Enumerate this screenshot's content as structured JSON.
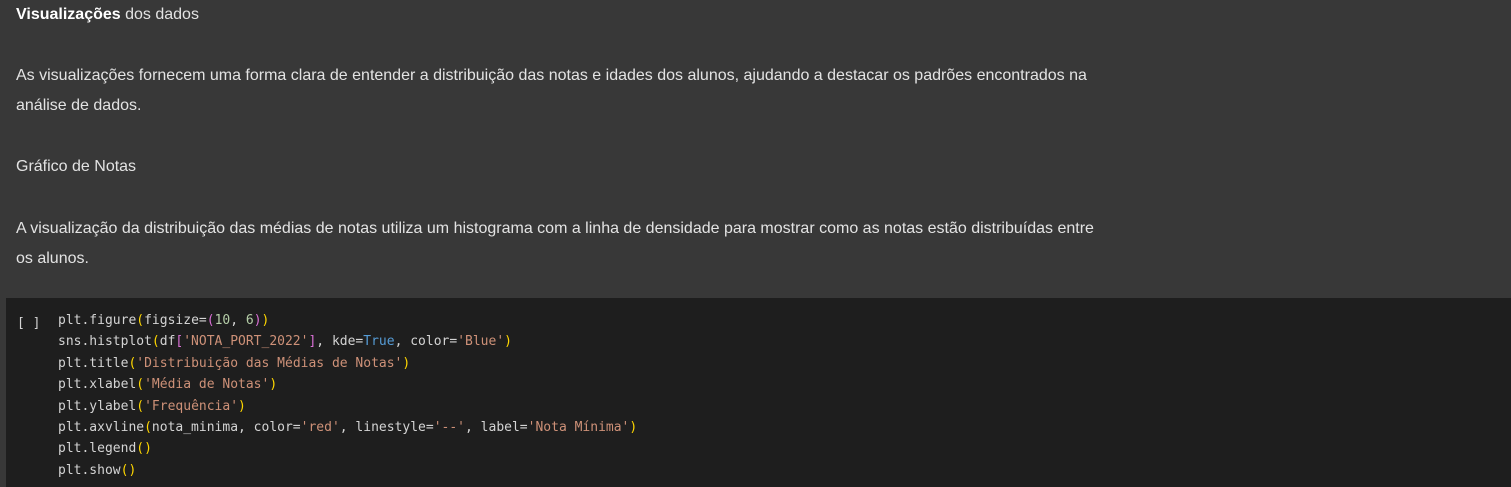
{
  "text_cell": {
    "heading_bold": "Visualizações",
    "heading_rest": " dos dados",
    "paragraph_1": "As visualizações fornecem uma forma clara de entender a distribuição das notas e idades dos alunos, ajudando a destacar os padrões encontrados na análise de dados.",
    "paragraph_2": "Gráfico de Notas",
    "paragraph_3": "A visualização da distribuição das médias de notas utiliza um histograma com a linha de densidade para mostrar como as notas estão distribuídas entre os alunos."
  },
  "code_cell": {
    "run_indicator": "[ ]",
    "lines": [
      [
        [
          "plain",
          "plt.figure"
        ],
        [
          "paren1",
          "("
        ],
        [
          "plain",
          "figsize="
        ],
        [
          "paren2",
          "("
        ],
        [
          "num",
          "10"
        ],
        [
          "plain",
          ", "
        ],
        [
          "num",
          "6"
        ],
        [
          "paren2",
          ")"
        ],
        [
          "paren1",
          ")"
        ]
      ],
      [
        [
          "plain",
          "sns.histplot"
        ],
        [
          "paren1",
          "("
        ],
        [
          "plain",
          "df"
        ],
        [
          "paren2",
          "["
        ],
        [
          "str",
          "'NOTA_PORT_2022'"
        ],
        [
          "paren2",
          "]"
        ],
        [
          "plain",
          ", kde="
        ],
        [
          "kw",
          "True"
        ],
        [
          "plain",
          ", color="
        ],
        [
          "str",
          "'Blue'"
        ],
        [
          "paren1",
          ")"
        ]
      ],
      [
        [
          "plain",
          "plt.title"
        ],
        [
          "paren1",
          "("
        ],
        [
          "str",
          "'Distribuição das Médias de Notas'"
        ],
        [
          "paren1",
          ")"
        ]
      ],
      [
        [
          "plain",
          "plt.xlabel"
        ],
        [
          "paren1",
          "("
        ],
        [
          "str",
          "'Média de Notas'"
        ],
        [
          "paren1",
          ")"
        ]
      ],
      [
        [
          "plain",
          "plt.ylabel"
        ],
        [
          "paren1",
          "("
        ],
        [
          "str",
          "'Frequência'"
        ],
        [
          "paren1",
          ")"
        ]
      ],
      [
        [
          "plain",
          "plt.axvline"
        ],
        [
          "paren1",
          "("
        ],
        [
          "plain",
          "nota_minima, color="
        ],
        [
          "str",
          "'red'"
        ],
        [
          "plain",
          ", linestyle="
        ],
        [
          "str",
          "'--'"
        ],
        [
          "plain",
          ", label="
        ],
        [
          "str",
          "'Nota Mínima'"
        ],
        [
          "paren1",
          ")"
        ]
      ],
      [
        [
          "plain",
          "plt.legend"
        ],
        [
          "paren1",
          "()"
        ]
      ],
      [
        [
          "plain",
          "plt.show"
        ],
        [
          "paren1",
          "()"
        ]
      ]
    ]
  }
}
